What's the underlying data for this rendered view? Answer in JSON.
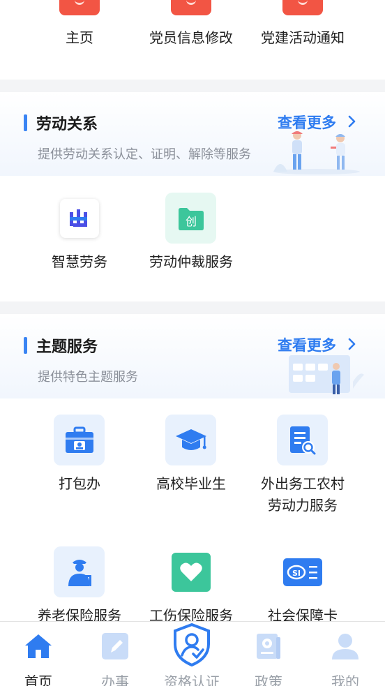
{
  "top_items": [
    {
      "label": "主页"
    },
    {
      "label": "党员信息修改"
    },
    {
      "label": "党建活动通知"
    }
  ],
  "labor": {
    "title": "劳动关系",
    "more": "查看更多",
    "subtitle": "提供劳动关系认定、证明、解除等服务",
    "items": [
      {
        "label": "智慧劳务",
        "icon": "smart-labor-icon"
      },
      {
        "label": "劳动仲裁服务",
        "icon": "arbitration-icon",
        "badge": "创"
      }
    ]
  },
  "theme": {
    "title": "主题服务",
    "more": "查看更多",
    "subtitle": "提供特色主题服务",
    "items": [
      {
        "label": "打包办",
        "icon": "package-icon"
      },
      {
        "label": "高校毕业生",
        "icon": "graduate-cap-icon"
      },
      {
        "label_line1": "外出务工农村",
        "label_line2": "劳动力服务",
        "icon": "document-search-icon"
      },
      {
        "label": "养老保险服务",
        "icon": "elderly-icon"
      },
      {
        "label": "工伤保险服务",
        "icon": "heart-icon"
      },
      {
        "label": "社会保障卡",
        "icon": "social-security-card-icon",
        "badge": "SI"
      }
    ]
  },
  "tabbar": [
    {
      "label": "首页",
      "icon": "home-icon",
      "active": true
    },
    {
      "label": "办事",
      "icon": "edit-icon",
      "active": false
    },
    {
      "label": "资格认证",
      "icon": "shield-person-icon",
      "active": false
    },
    {
      "label": "政策",
      "icon": "policy-book-icon",
      "active": false
    },
    {
      "label": "我的",
      "icon": "user-icon",
      "active": false
    }
  ],
  "colors": {
    "accent": "#2f7cf0",
    "party_red": "#f25544",
    "green": "#3cc69b",
    "light_blue_tile": "#e8f1fd"
  }
}
